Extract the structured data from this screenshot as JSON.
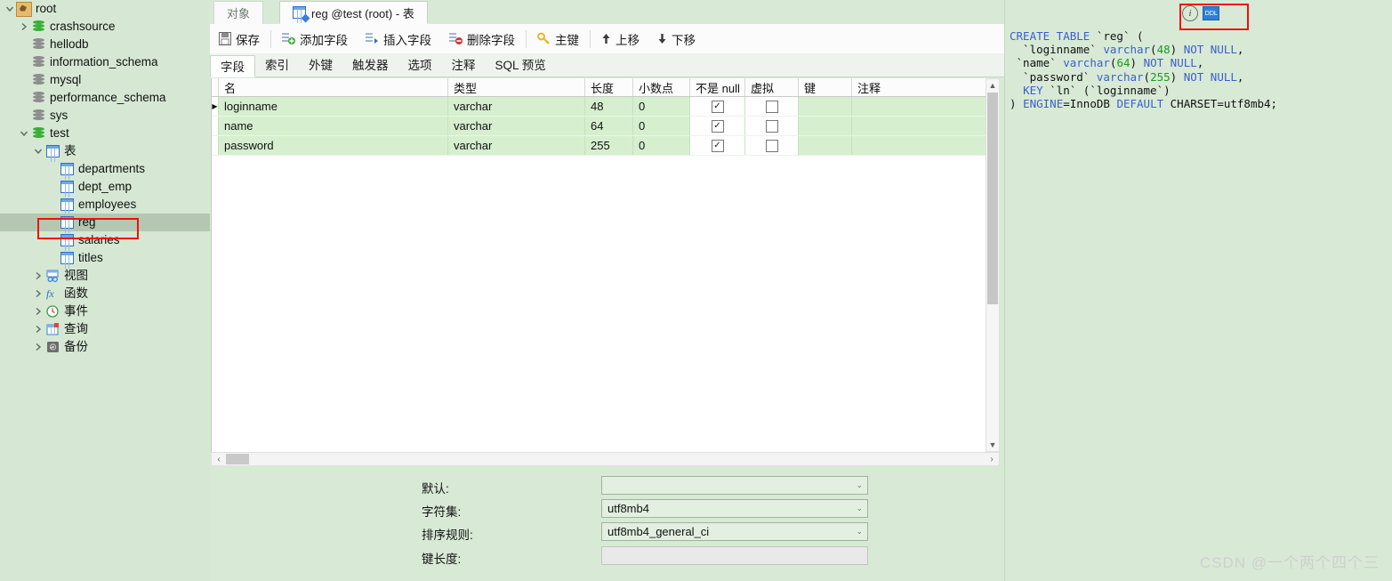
{
  "sidebar": {
    "nodes": [
      {
        "label": "root",
        "indent": 0,
        "icon": "app-root-icon",
        "twisty": "down",
        "type": "root"
      },
      {
        "label": "crashsource",
        "indent": 1,
        "icon": "database-green-icon",
        "twisty": "right",
        "type": "db"
      },
      {
        "label": "hellodb",
        "indent": 1,
        "icon": "database-gray-icon",
        "twisty": "none",
        "type": "db"
      },
      {
        "label": "information_schema",
        "indent": 1,
        "icon": "database-gray-icon",
        "twisty": "none",
        "type": "db"
      },
      {
        "label": "mysql",
        "indent": 1,
        "icon": "database-gray-icon",
        "twisty": "none",
        "type": "db"
      },
      {
        "label": "performance_schema",
        "indent": 1,
        "icon": "database-gray-icon",
        "twisty": "none",
        "type": "db"
      },
      {
        "label": "sys",
        "indent": 1,
        "icon": "database-gray-icon",
        "twisty": "none",
        "type": "db"
      },
      {
        "label": "test",
        "indent": 1,
        "icon": "database-green-icon",
        "twisty": "down",
        "type": "db"
      },
      {
        "label": "表",
        "indent": 2,
        "icon": "table-folder-icon",
        "twisty": "down",
        "type": "group"
      },
      {
        "label": "departments",
        "indent": 3,
        "icon": "table-icon",
        "twisty": "none",
        "type": "table"
      },
      {
        "label": "dept_emp",
        "indent": 3,
        "icon": "table-icon",
        "twisty": "none",
        "type": "table"
      },
      {
        "label": "employees",
        "indent": 3,
        "icon": "table-icon",
        "twisty": "none",
        "type": "table"
      },
      {
        "label": "reg",
        "indent": 3,
        "icon": "table-icon",
        "twisty": "none",
        "type": "table",
        "selected": true,
        "annotated": true
      },
      {
        "label": "salaries",
        "indent": 3,
        "icon": "table-icon",
        "twisty": "none",
        "type": "table"
      },
      {
        "label": "titles",
        "indent": 3,
        "icon": "table-icon",
        "twisty": "none",
        "type": "table"
      },
      {
        "label": "视图",
        "indent": 2,
        "icon": "view-icon",
        "twisty": "right",
        "type": "group"
      },
      {
        "label": "函数",
        "indent": 2,
        "icon": "function-fx-icon",
        "twisty": "right",
        "type": "group"
      },
      {
        "label": "事件",
        "indent": 2,
        "icon": "event-clock-icon",
        "twisty": "right",
        "type": "group"
      },
      {
        "label": "查询",
        "indent": 2,
        "icon": "query-icon",
        "twisty": "right",
        "type": "group"
      },
      {
        "label": "备份",
        "indent": 2,
        "icon": "backup-icon",
        "twisty": "right",
        "type": "group"
      }
    ]
  },
  "tabs": {
    "object_tab": "对象",
    "editor_tab": "reg @test (root) - 表"
  },
  "toolbar": {
    "save": "保存",
    "add_field": "添加字段",
    "insert_field": "插入字段",
    "delete_field": "删除字段",
    "primary_key": "主键",
    "move_up": "上移",
    "move_down": "下移"
  },
  "subtabs": [
    {
      "label": "字段",
      "active": true
    },
    {
      "label": "索引",
      "active": false
    },
    {
      "label": "外键",
      "active": false
    },
    {
      "label": "触发器",
      "active": false
    },
    {
      "label": "选项",
      "active": false
    },
    {
      "label": "注释",
      "active": false
    },
    {
      "label": "SQL 预览",
      "active": false
    }
  ],
  "grid": {
    "columns": [
      "名",
      "类型",
      "长度",
      "小数点",
      "不是 null",
      "虚拟",
      "键",
      "注释"
    ],
    "rows": [
      {
        "name": "loginname",
        "type": "varchar",
        "length": "48",
        "decimals": "0",
        "not_null": true,
        "virtual": false,
        "key": "",
        "comment": "",
        "current": true
      },
      {
        "name": "name",
        "type": "varchar",
        "length": "64",
        "decimals": "0",
        "not_null": true,
        "virtual": false,
        "key": "",
        "comment": "",
        "current": false
      },
      {
        "name": "password",
        "type": "varchar",
        "length": "255",
        "decimals": "0",
        "not_null": true,
        "virtual": false,
        "key": "",
        "comment": "",
        "current": false
      }
    ],
    "check_glyph": "✓",
    "row_marker": "▶"
  },
  "form": {
    "default_label": "默认:",
    "default_value": "",
    "charset_label": "字符集:",
    "charset_value": "utf8mb4",
    "collation_label": "排序规则:",
    "collation_value": "utf8mb4_general_ci",
    "keylen_label": "键长度:",
    "keylen_value": "",
    "chevron": "⌄"
  },
  "sql_panel": {
    "info_icon_glyph": "i",
    "ddl_badge": "DDL",
    "lines": [
      [
        {
          "t": "CREATE TABLE ",
          "c": "kw"
        },
        {
          "t": "`reg` (",
          "c": "plain"
        }
      ],
      [
        {
          "t": "  `loginname` ",
          "c": "plain"
        },
        {
          "t": "varchar",
          "c": "kw"
        },
        {
          "t": "(",
          "c": "plain"
        },
        {
          "t": "48",
          "c": "num"
        },
        {
          "t": ") ",
          "c": "plain"
        },
        {
          "t": "NOT NULL",
          "c": "kw"
        },
        {
          "t": ",",
          "c": "plain"
        }
      ],
      [
        {
          "t": " `name` ",
          "c": "plain"
        },
        {
          "t": "varchar",
          "c": "kw"
        },
        {
          "t": "(",
          "c": "plain"
        },
        {
          "t": "64",
          "c": "num"
        },
        {
          "t": ") ",
          "c": "plain"
        },
        {
          "t": "NOT NULL",
          "c": "kw"
        },
        {
          "t": ",",
          "c": "plain"
        }
      ],
      [
        {
          "t": "  `password` ",
          "c": "plain"
        },
        {
          "t": "varchar",
          "c": "kw"
        },
        {
          "t": "(",
          "c": "plain"
        },
        {
          "t": "255",
          "c": "num"
        },
        {
          "t": ") ",
          "c": "plain"
        },
        {
          "t": "NOT NULL",
          "c": "kw"
        },
        {
          "t": ",",
          "c": "plain"
        }
      ],
      [
        {
          "t": "  ",
          "c": "plain"
        },
        {
          "t": "KEY",
          "c": "kw"
        },
        {
          "t": " `ln` (`loginname`)",
          "c": "plain"
        }
      ],
      [
        {
          "t": ") ",
          "c": "plain"
        },
        {
          "t": "ENGINE",
          "c": "kw"
        },
        {
          "t": "=InnoDB ",
          "c": "plain"
        },
        {
          "t": "DEFAULT",
          "c": "kw"
        },
        {
          "t": " CHARSET=utf8mb4;",
          "c": "plain"
        }
      ]
    ]
  },
  "watermark": "CSDN @一个两个四个三",
  "colors": {
    "sidebar_bg": "#d6e8d4",
    "selection": "#b4c8b1",
    "grid_row": "#d6efcf",
    "annotation": "#ee1111",
    "keyword": "#3a5fcd",
    "number": "#1a9a1a"
  }
}
